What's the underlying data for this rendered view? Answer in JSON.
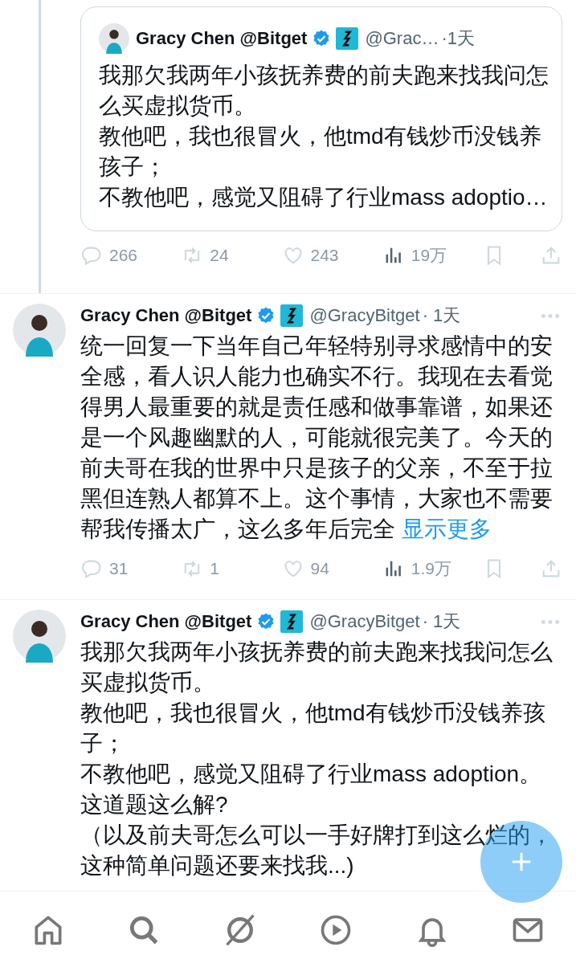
{
  "tweets": [
    {
      "kind": "quote",
      "quote": {
        "name": "Gracy Chen @Bitget",
        "handle": "@Grac…",
        "time": "·1天",
        "lines": [
          "我那欠我两年小孩抚养费的前夫跑来找我问怎么买虚拟货币。",
          "教他吧，我也很冒火，他tmd有钱炒币没钱养孩子；",
          "不教他吧，感觉又阻碍了行业mass adoptio…"
        ]
      },
      "actions": {
        "replies": "266",
        "reposts": "24",
        "likes": "243",
        "views": "19万"
      }
    },
    {
      "kind": "post",
      "name": "Gracy Chen @Bitget",
      "handle": "@GracyBitget",
      "time": "· 1天",
      "lines": [
        "统一回复一下当年自己年轻特别寻求感情中的安全感，看人识人能力也确实不行。我现在去看觉得男人最重要的就是责任感和做事靠谱，如果还是一个风趣幽默的人，可能就很完美了。今天的前夫哥在我的世界中只是孩子的父亲，不至于拉黑但连熟人都算不上。这个事情，大家也不需要帮我传播太广，这么多年后完全"
      ],
      "more_link": "显示更多",
      "actions": {
        "replies": "31",
        "reposts": "1",
        "likes": "94",
        "views": "1.9万"
      }
    },
    {
      "kind": "post",
      "name": "Gracy Chen @Bitget",
      "handle": "@GracyBitget",
      "time": "· 1天",
      "lines": [
        "我那欠我两年小孩抚养费的前夫跑来找我问怎么买虚拟货币。",
        "教他吧，我也很冒火，他tmd有钱炒币没钱养孩子；",
        "不教他吧，感觉又阻碍了行业mass adoption。",
        "这道题这么解?",
        "（以及前夫哥怎么可以一手好牌打到这么烂的，",
        "这种简单问题还要来找我...)"
      ]
    }
  ],
  "nav": [
    {
      "kind": "home"
    },
    {
      "kind": "search"
    },
    {
      "kind": "grok"
    },
    {
      "kind": "video"
    },
    {
      "kind": "notifications"
    },
    {
      "kind": "messages"
    }
  ]
}
